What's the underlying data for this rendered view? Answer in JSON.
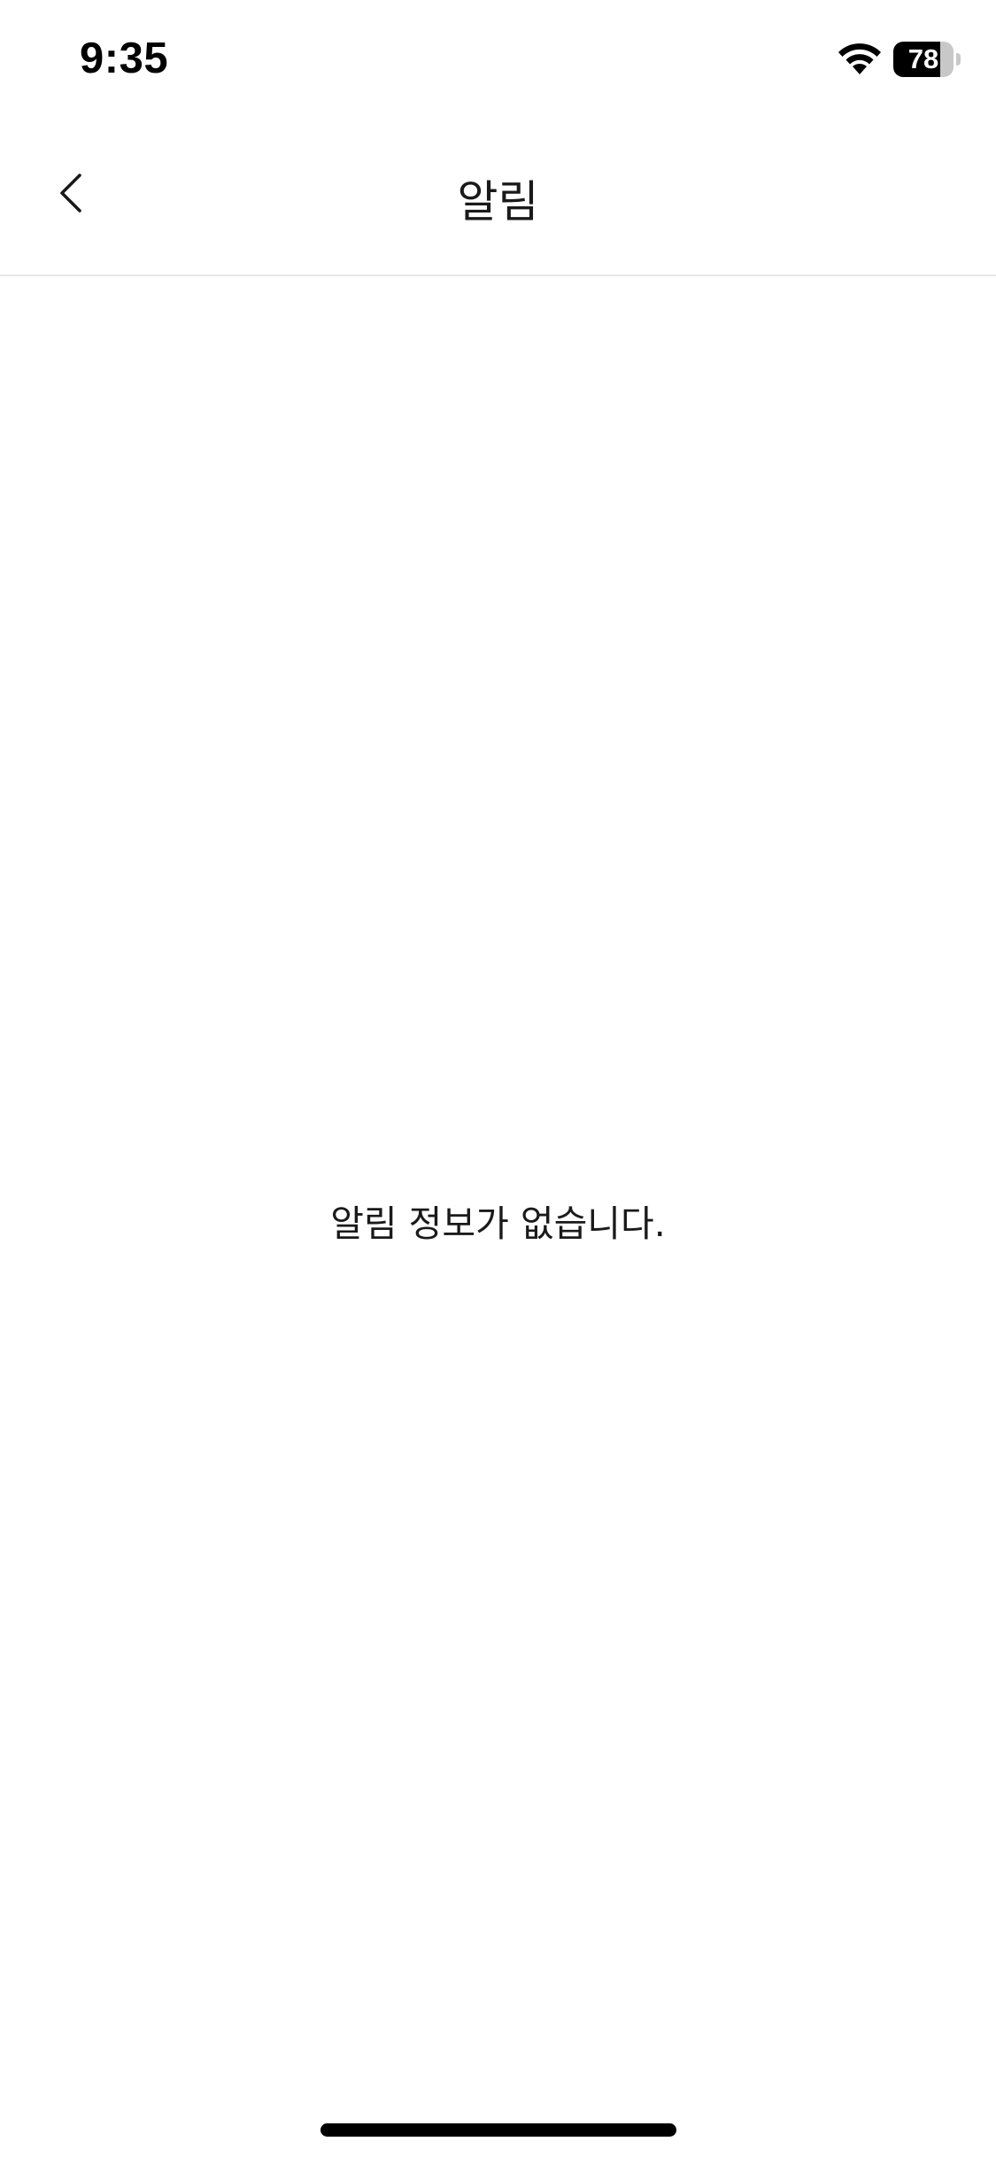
{
  "status_bar": {
    "time": "9:35",
    "battery_level": "78",
    "battery_fraction": 0.78,
    "wifi_icon": "wifi-icon"
  },
  "nav": {
    "title": "알림",
    "back_icon": "chevron-left-icon"
  },
  "main": {
    "empty_message": "알림 정보가 없습니다."
  },
  "colors": {
    "background": "#ffffff",
    "text": "#1a1a1a",
    "divider": "#e8e8e8"
  }
}
